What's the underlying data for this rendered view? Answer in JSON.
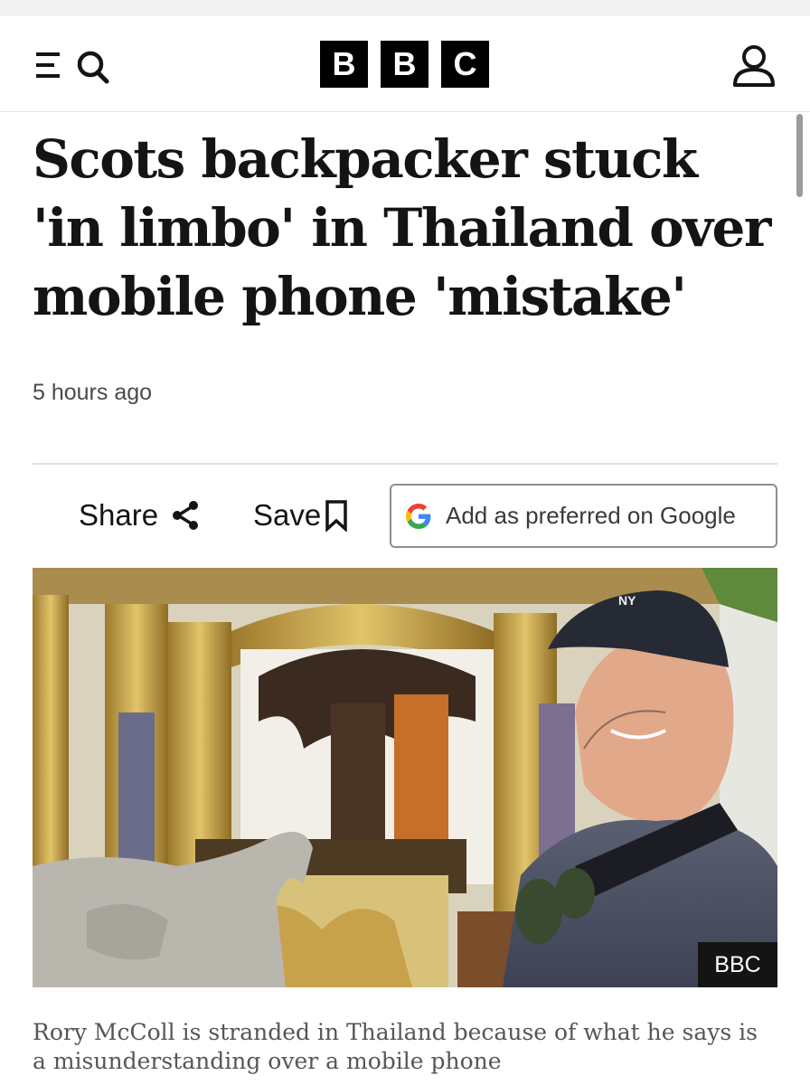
{
  "header": {
    "logo_letters": [
      "B",
      "B",
      "C"
    ],
    "menu_icon": "menu-icon",
    "search_icon": "search-icon",
    "account_icon": "account-icon"
  },
  "article": {
    "headline": "Scots backpacker stuck 'in limbo' in Thailand over mobile phone 'mistake'",
    "timestamp": "5 hours ago",
    "actions": {
      "share_label": "Share",
      "save_label": "Save",
      "google_label": "Add as preferred on Google"
    },
    "image": {
      "credit": "BBC",
      "cap_logo": "NY"
    },
    "caption": "Rory McColl is stranded in Thailand because of what he says is a misunderstanding over a mobile phone"
  },
  "colors": {
    "brand_black": "#000000",
    "text": "#141414",
    "muted": "#4a4a4a",
    "google_blue": "#4285F4",
    "google_red": "#EA4335",
    "google_yellow": "#FBBC05",
    "google_green": "#34A853"
  }
}
